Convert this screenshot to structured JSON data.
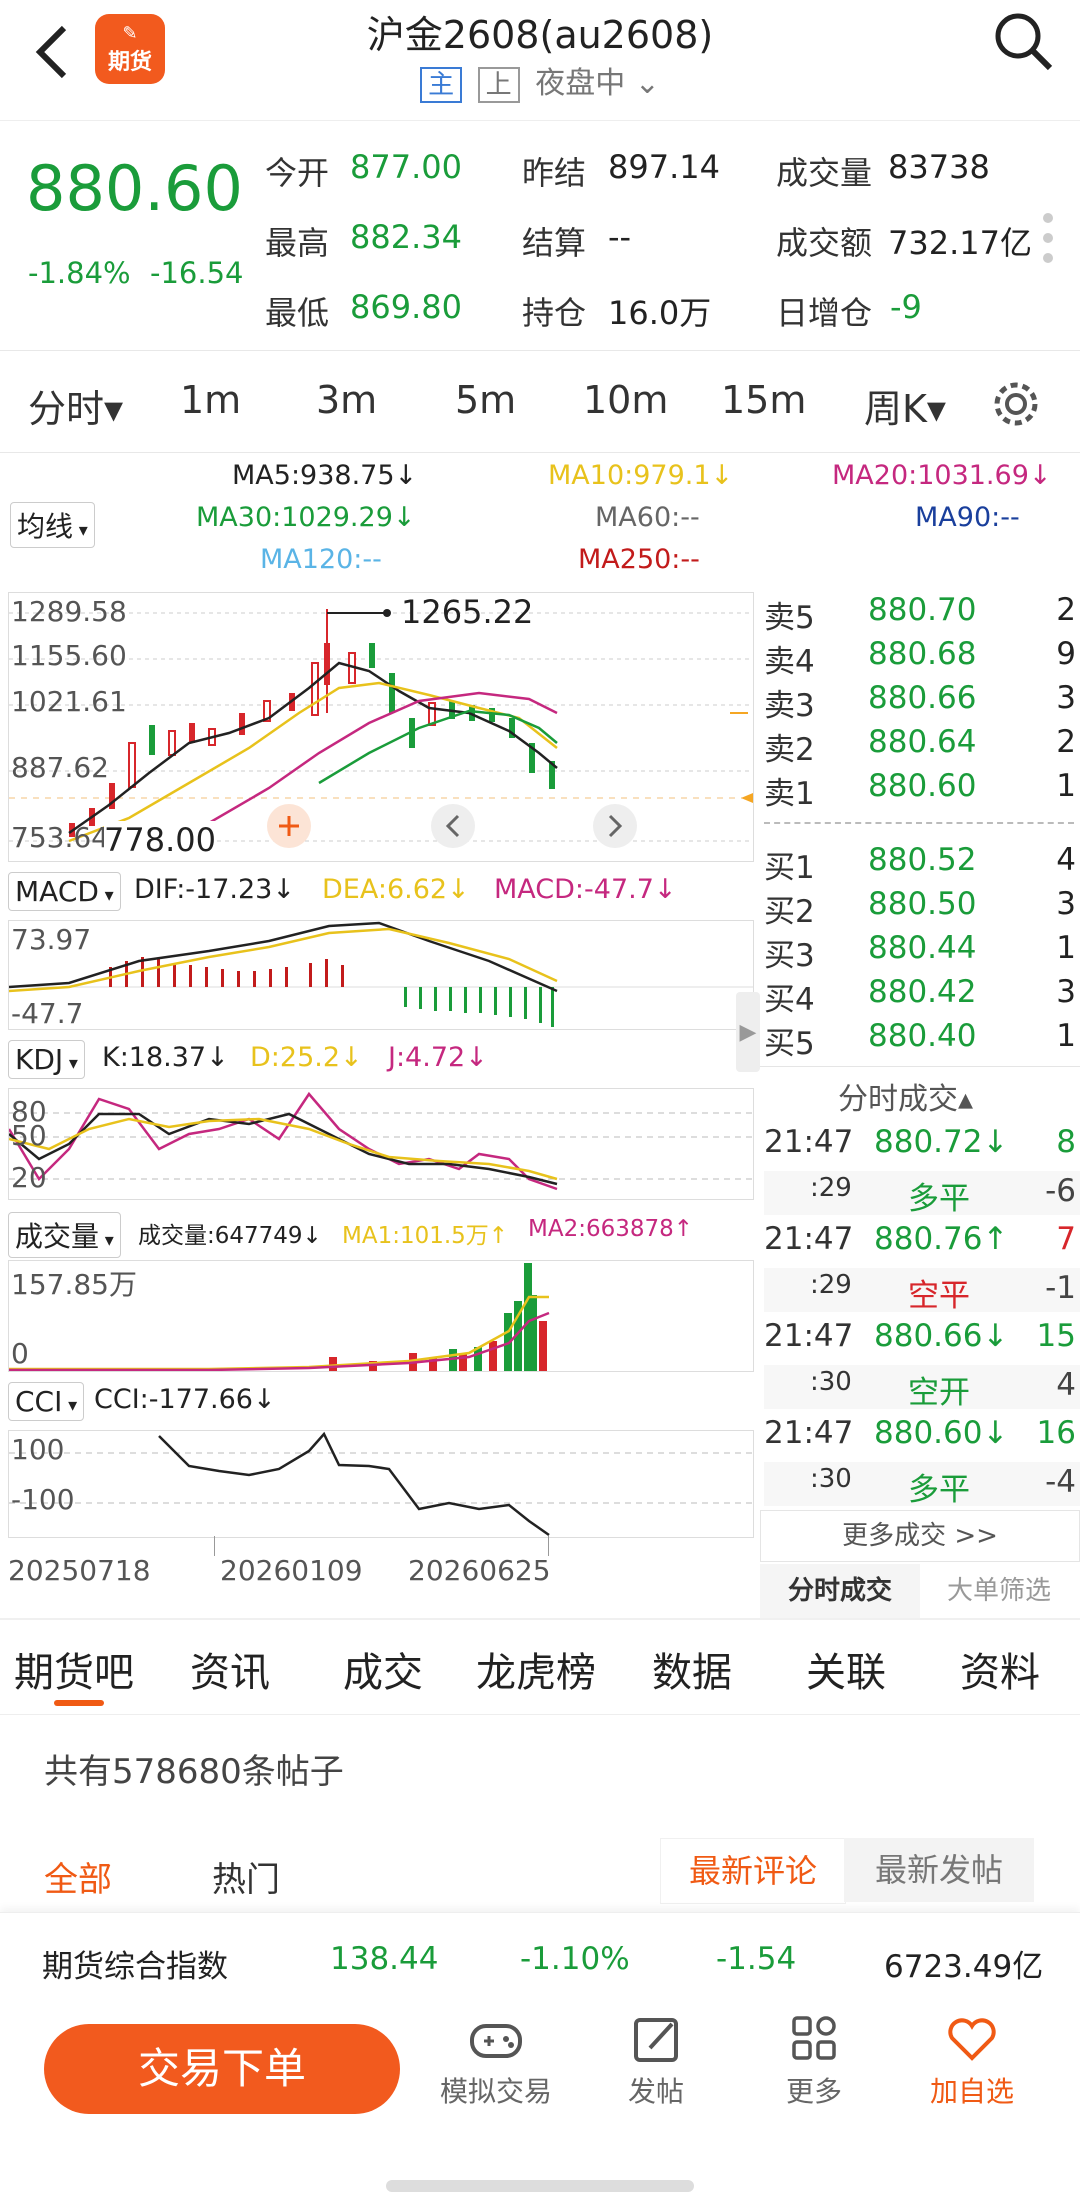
{
  "header": {
    "logo_text": "期货",
    "title": "沪金2608(au2608)",
    "tag_main": "主",
    "tag_shang": "上",
    "session": "夜盘中"
  },
  "quote": {
    "price": "880.60",
    "change_pct": "-1.84%",
    "change": "-16.54",
    "open_k": "今开",
    "open_v": "877.00",
    "prev_close_k": "昨结",
    "prev_close_v": "897.14",
    "volume_k": "成交量",
    "volume_v": "83738",
    "high_k": "最高",
    "high_v": "882.34",
    "settle_k": "结算",
    "settle_v": "--",
    "turnover_k": "成交额",
    "turnover_v": "732.17亿",
    "low_k": "最低",
    "low_v": "869.80",
    "oi_k": "持仓",
    "oi_v": "16.0万",
    "oi_chg_k": "日增仓",
    "oi_chg_v": "-9"
  },
  "periods": [
    "分时▾",
    "1m",
    "3m",
    "5m",
    "10m",
    "15m",
    "周K▾"
  ],
  "ma": {
    "indicator": "均线",
    "ma5": "MA5:938.75↓",
    "ma10": "MA10:979.1↓",
    "ma20": "MA20:1031.69↓",
    "ma30": "MA30:1029.29↓",
    "ma60": "MA60:--",
    "ma90": "MA90:--",
    "ma120": "MA120:--",
    "ma250": "MA250:--"
  },
  "price_axis": [
    "1289.58",
    "1155.60",
    "1021.61",
    "887.62",
    "753.64"
  ],
  "price_high_label": "1265.22",
  "price_low_label": "778.00",
  "macd": {
    "name": "MACD",
    "dif": "DIF:-17.23↓",
    "dea": "DEA:6.62↓",
    "macd": "MACD:-47.7↓",
    "top": "73.97",
    "bottom": "-47.7"
  },
  "kdj": {
    "name": "KDJ",
    "k": "K:18.37↓",
    "d": "D:25.2↓",
    "j": "J:4.72↓",
    "l80": "80",
    "l50": "50",
    "l20": "20"
  },
  "vol": {
    "name": "成交量",
    "v": "成交量:647749↓",
    "ma1": "MA1:101.5万↑",
    "ma2": "MA2:663878↑",
    "top": "157.85万",
    "zero": "0"
  },
  "cci": {
    "name": "CCI",
    "v": "CCI:-177.66↓",
    "l100": "100",
    "lm100": "-100"
  },
  "dates": [
    "20250718",
    "20260109",
    "20260625"
  ],
  "asks": [
    {
      "k": "卖5",
      "p": "880.70",
      "q": "2"
    },
    {
      "k": "卖4",
      "p": "880.68",
      "q": "9"
    },
    {
      "k": "卖3",
      "p": "880.66",
      "q": "3"
    },
    {
      "k": "卖2",
      "p": "880.64",
      "q": "2"
    },
    {
      "k": "卖1",
      "p": "880.60",
      "q": "1"
    }
  ],
  "bids": [
    {
      "k": "买1",
      "p": "880.52",
      "q": "4"
    },
    {
      "k": "买2",
      "p": "880.50",
      "q": "3"
    },
    {
      "k": "买3",
      "p": "880.44",
      "q": "1"
    },
    {
      "k": "买4",
      "p": "880.42",
      "q": "3"
    },
    {
      "k": "买5",
      "p": "880.40",
      "q": "1"
    }
  ],
  "ticks_title": "分时成交▴",
  "ticks": [
    {
      "t": "21:47",
      "p": "880.72↓",
      "q": "8",
      "pc": "green",
      "qc": "green"
    },
    {
      "t": ":29",
      "p": "多平",
      "q": "-6",
      "pc": "green",
      "qc": "gray"
    },
    {
      "t": "21:47",
      "p": "880.76↑",
      "q": "7",
      "pc": "green",
      "qc": "red"
    },
    {
      "t": ":29",
      "p": "空平",
      "q": "-1",
      "pc": "red",
      "qc": "gray"
    },
    {
      "t": "21:47",
      "p": "880.66↓",
      "q": "15",
      "pc": "green",
      "qc": "green"
    },
    {
      "t": ":30",
      "p": "空开",
      "q": "4",
      "pc": "green",
      "qc": "gray"
    },
    {
      "t": "21:47",
      "p": "880.60↓",
      "q": "16",
      "pc": "green",
      "qc": "green"
    },
    {
      "t": ":30",
      "p": "多平",
      "q": "-4",
      "pc": "green",
      "qc": "gray"
    }
  ],
  "more_ticks": "更多成交 >>",
  "tick_tabs": [
    "分时成交",
    "大单筛选"
  ],
  "bottom_tabs": [
    "期货吧",
    "资讯",
    "成交",
    "龙虎榜",
    "数据",
    "关联",
    "资料"
  ],
  "posts_count": "共有578680条帖子",
  "filter": {
    "all": "全部",
    "hot": "热门",
    "latest_comment": "最新评论",
    "latest_post": "最新发帖"
  },
  "index_bar": {
    "name": "期货综合指数",
    "value": "138.44",
    "pct": "-1.10%",
    "chg": "-1.54",
    "amount": "6723.49亿"
  },
  "nav": {
    "trade": "交易下单",
    "sim": "模拟交易",
    "post": "发帖",
    "more": "更多",
    "fav": "加自选"
  },
  "colors": {
    "accent": "#f05a14",
    "up": "#d7262b",
    "down": "#1a9c3a"
  }
}
